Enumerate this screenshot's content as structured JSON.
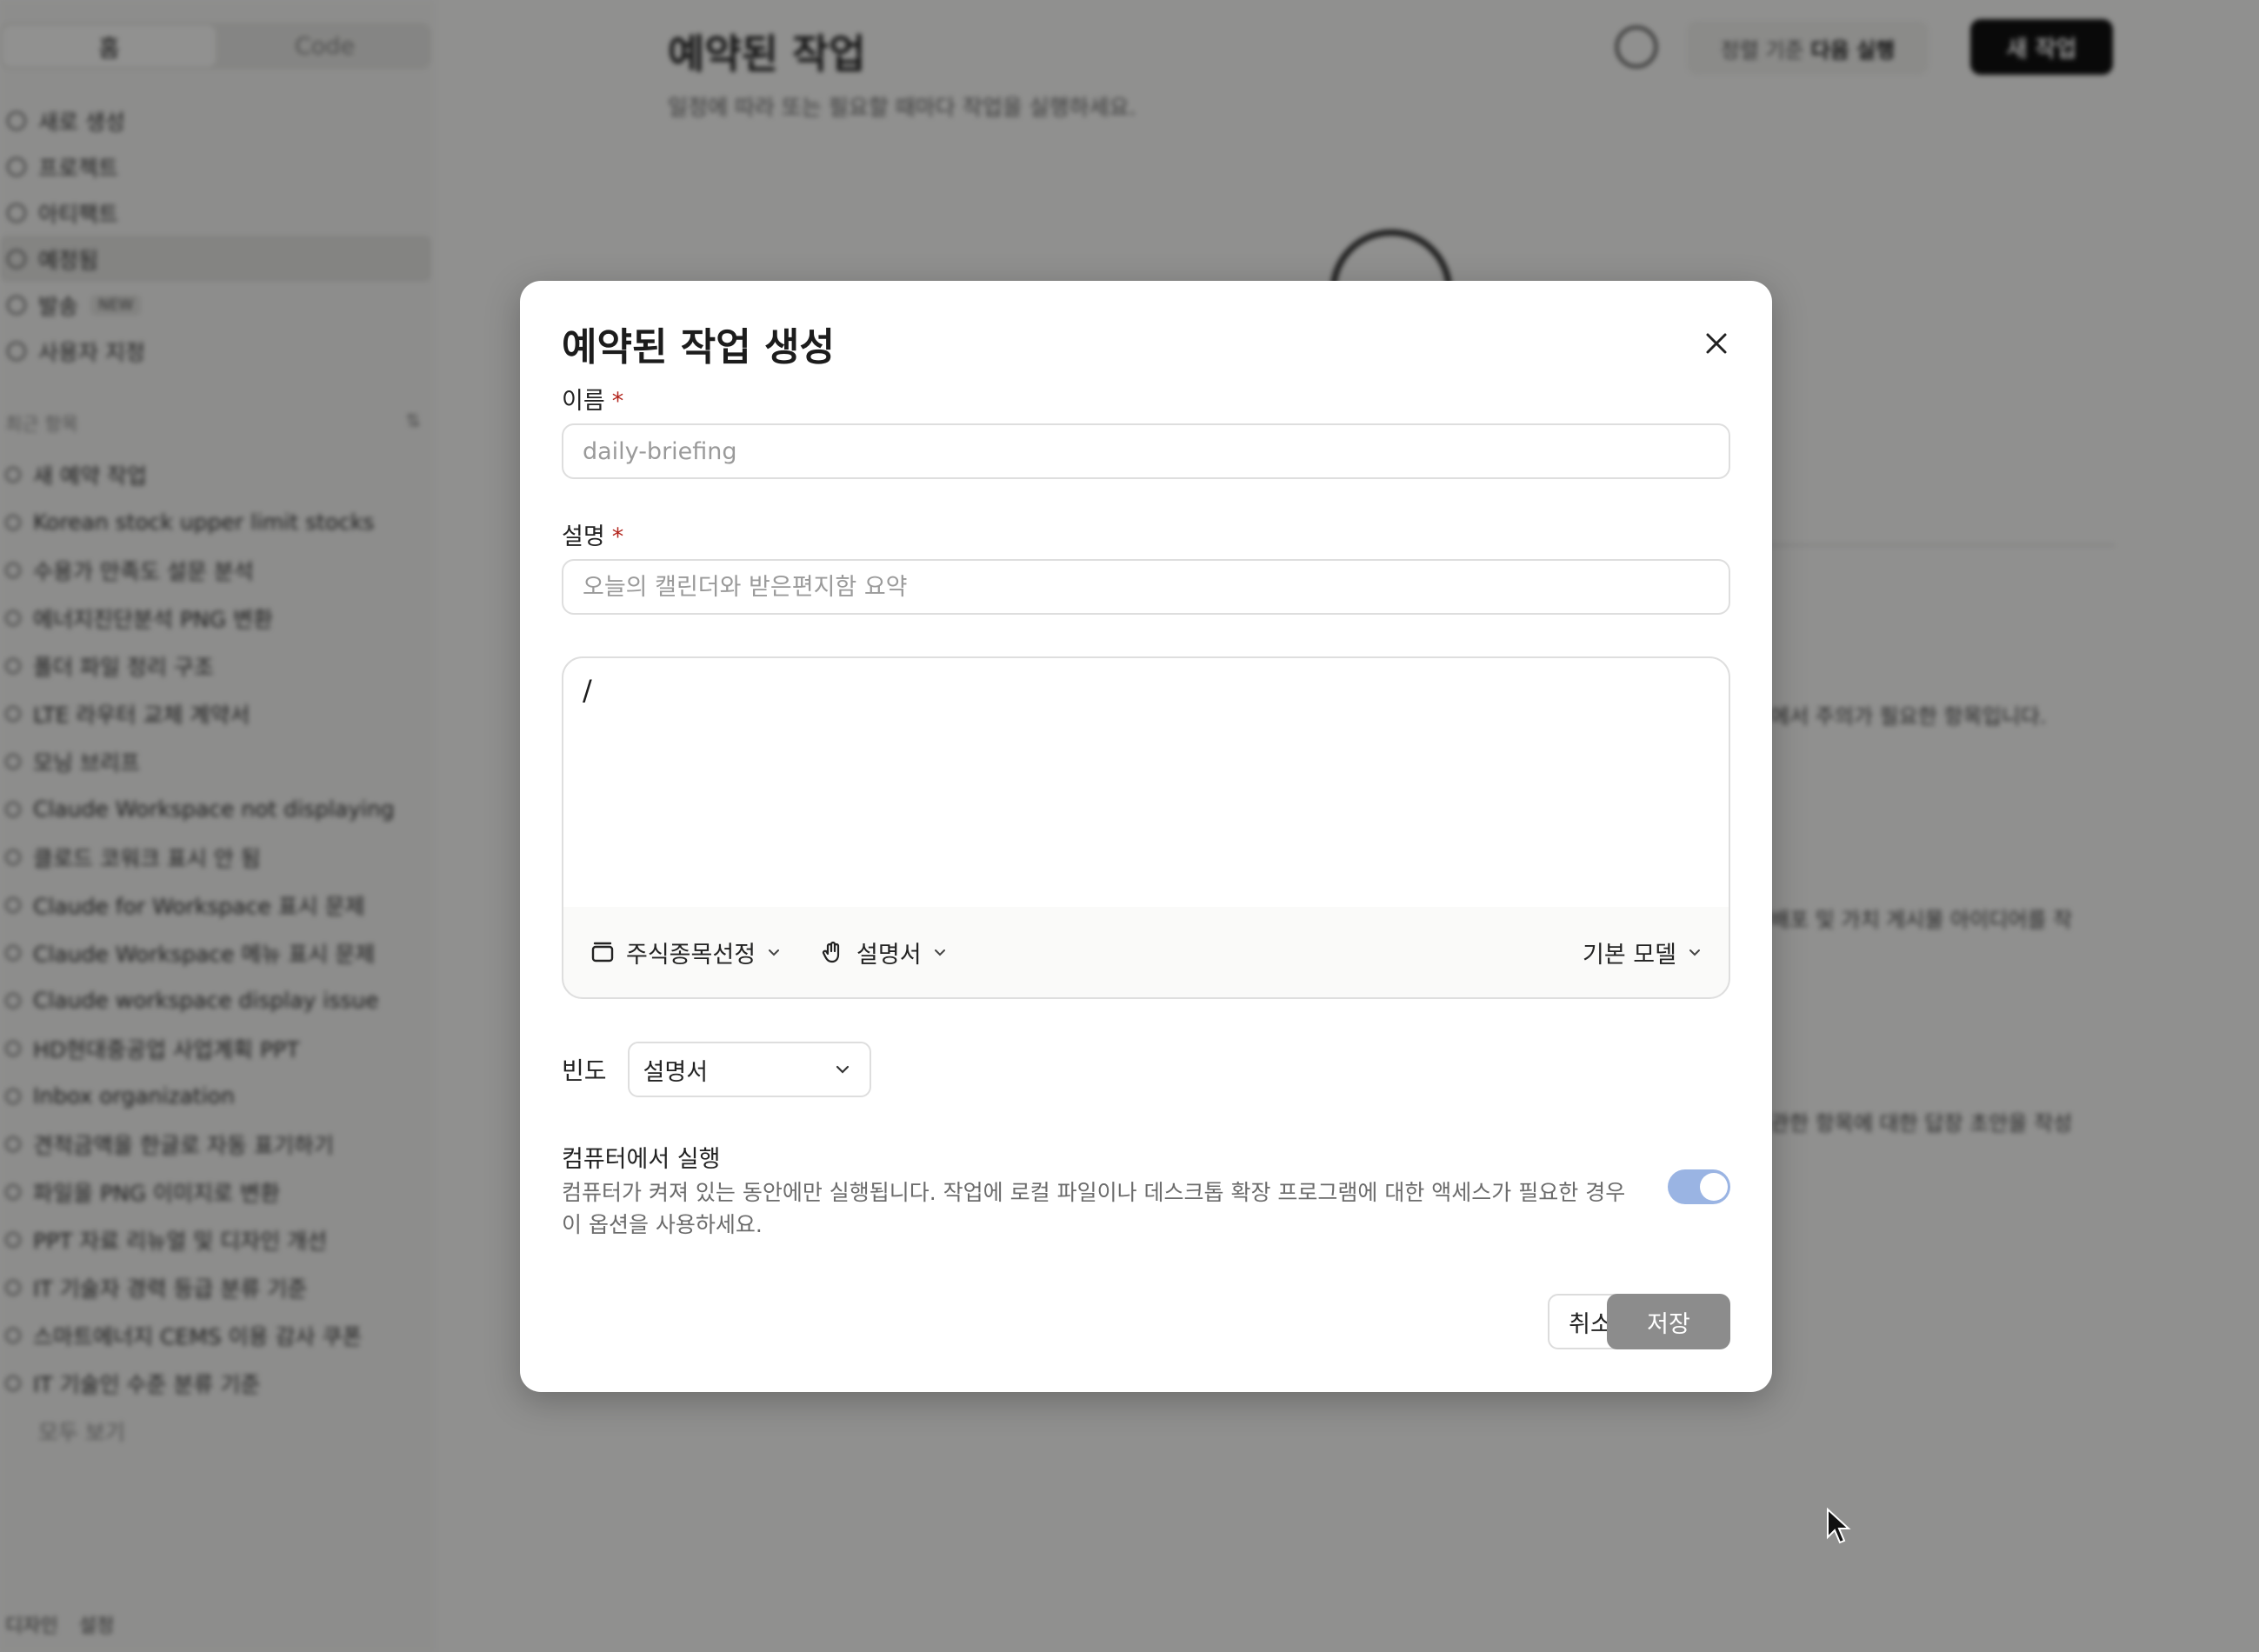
{
  "sidebar": {
    "tabs": [
      {
        "label": "홈"
      },
      {
        "label": "Code"
      }
    ],
    "nav": [
      {
        "label": "새로 생성"
      },
      {
        "label": "프로젝트"
      },
      {
        "label": "아티팩트"
      },
      {
        "label": "예정됨"
      },
      {
        "label": "발송",
        "badge": "NEW"
      },
      {
        "label": "사용자 지정"
      }
    ],
    "recents_label": "최근 항목",
    "recents_shortcut": "⇅",
    "recents": [
      "새 예약 작업",
      "Korean stock upper limit stocks",
      "수용가 만족도 설문 분석",
      "에너지진단분석 PNG 변환",
      "폴더 파일 정리 구조",
      "LTE 라우터 교체 계약서",
      "모닝 브리프",
      "Claude Workspace not displaying",
      "클로드 코워크 표시 안 됨",
      "Claude for Workspace 표시 문제",
      "Claude Workspace 메뉴 표시 문제",
      "Claude workspace display issue",
      "HD현대중공업 사업계획 PPT",
      "Inbox organization",
      "견적금액을 한글로 자동 표기하기",
      "파일을 PNG 이미지로 변환",
      "PPT 자료 리뉴얼 및 디자인 개선",
      "IT 기술자 경력 등급 분류 기준",
      "스마트에너지 CEMS 이용 감사 쿠폰",
      "IT 기술인 수준 분류 기준"
    ],
    "show_all": "모두 보기",
    "footer": {
      "left": "디자인",
      "right": "설정"
    }
  },
  "main": {
    "title": "예약된 작업",
    "subtitle": "일정에 따라 또는 필요할 때마다 작업을 실행하세요.",
    "sort_prefix": "정렬 기준",
    "sort_value": "다음 실행",
    "new_task": "새 작업",
    "bg_snippets": [
      "에서 주의가 필요한 항목입니다.",
      "배포 및 가치 게시물 아이디어를 작",
      "관한 항목에 대한 답장 초안을 작성"
    ]
  },
  "modal": {
    "title": "예약된 작업 생성",
    "name_label": "이름",
    "name_placeholder": "daily-briefing",
    "desc_label": "설명",
    "desc_placeholder": "오늘의 캘린더와 받은편지함 요약",
    "required_mark": "*",
    "prompt_value": "/",
    "toolbar": {
      "folder_label": "주식종목선정",
      "skill_label": "설명서",
      "model_label": "기본 모델"
    },
    "frequency_label": "빈도",
    "frequency_value": "설명서",
    "run_on_computer_title": "컴퓨터에서 실행",
    "run_on_computer_desc": "컴퓨터가 켜져 있는 동안에만 실행됩니다. 작업에 로컬 파일이나 데스크톱 확장 프로그램에 대한 액세스가 필요한 경우 이 옵션을 사용하세요.",
    "toggle_on": true,
    "cancel_label": "취소",
    "save_label": "저장"
  },
  "colors": {
    "overlay": "#000000",
    "toggle": "#9ab4e3",
    "save": "#8c8c8c",
    "required": "#b3261e"
  }
}
